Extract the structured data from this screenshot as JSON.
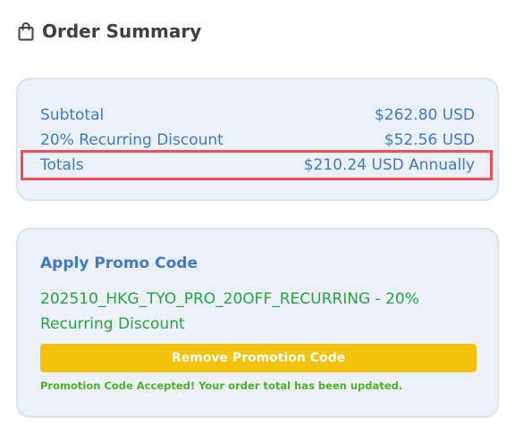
{
  "header": {
    "title": "Order Summary",
    "icon": "shopping-bag-icon"
  },
  "summary": {
    "subtotal_label": "Subtotal",
    "subtotal_value": "$262.80 USD",
    "discount_label": "20% Recurring Discount",
    "discount_value": "$52.56 USD",
    "totals_label": "Totals",
    "totals_value": "$210.24 USD Annually"
  },
  "promo": {
    "title": "Apply Promo Code",
    "applied_code": "202510_HKG_TYO_PRO_20OFF_RECURRING - 20% Recurring Discount",
    "remove_button_label": "Remove Promotion Code",
    "status_message": "Promotion Code Accepted! Your order total has been updated."
  },
  "colors": {
    "card_background": "#ebf0f9",
    "card_border": "#dbe4f3",
    "text_blue": "#3f7bc7",
    "success_green": "#2aa43c",
    "button_yellow": "#f2c20d",
    "highlight_red": "#ef4f52"
  }
}
